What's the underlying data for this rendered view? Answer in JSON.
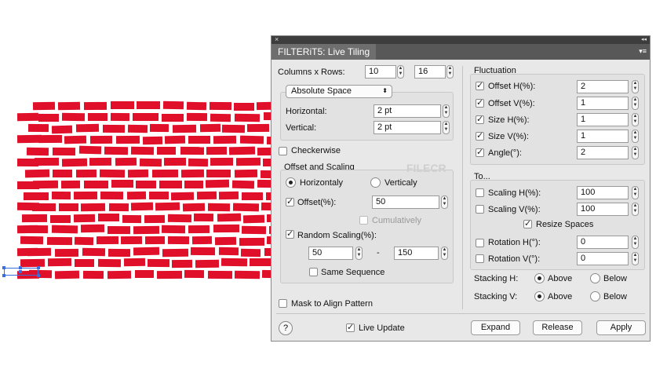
{
  "panel": {
    "close_glyph": "×",
    "collapse_glyph": "◂◂",
    "menu_glyph": "▾≡",
    "title": "FILTERiT5: Live Tiling"
  },
  "left": {
    "cols_rows_label": "Columns x Rows:",
    "columns": "10",
    "rows": "16",
    "space_mode": "Absolute Space",
    "horizontal_label": "Horizontal:",
    "horizontal": "2 pt",
    "vertical_label": "Vertical:",
    "vertical": "2 pt",
    "checkerwise_label": "Checkerwise",
    "offset_scaling_title": "Offset and Scaling",
    "horizontally_label": "Horizontaly",
    "vertically_label": "Verticaly",
    "offset_label": "Offset(%):",
    "offset": "50",
    "cumulatively_label": "Cumulatively",
    "random_scaling_label": "Random Scaling(%):",
    "random_min": "50",
    "random_dash": "-",
    "random_max": "150",
    "same_sequence_label": "Same Sequence",
    "mask_label": "Mask to Align Pattern"
  },
  "right": {
    "fluctuation_title": "Fluctuation",
    "fluct": [
      {
        "label": "Offset H(%):",
        "value": "2",
        "checked": true
      },
      {
        "label": "Offset V(%):",
        "value": "1",
        "checked": true
      },
      {
        "label": "Size H(%):",
        "value": "1",
        "checked": true
      },
      {
        "label": "Size V(%):",
        "value": "1",
        "checked": true
      },
      {
        "label": "Angle(°):",
        "value": "2",
        "checked": true
      }
    ],
    "to_title": "To...",
    "scaling_h_label": "Scaling H(%):",
    "scaling_h": "100",
    "scaling_v_label": "Scaling V(%):",
    "scaling_v": "100",
    "resize_spaces_label": "Resize Spaces",
    "rotation_h_label": "Rotation H(°):",
    "rotation_h": "0",
    "rotation_v_label": "Rotation V(°):",
    "rotation_v": "0",
    "stacking_h_label": "Stacking H:",
    "stacking_v_label": "Stacking V:",
    "above_label": "Above",
    "below_label": "Below"
  },
  "footer": {
    "help": "?",
    "live_update_label": "Live Update",
    "expand": "Expand",
    "release": "Release",
    "apply": "Apply"
  },
  "check_glyph": "✓",
  "spin_up": "▲",
  "spin_down": "▼",
  "dropdown_arrows": "⬍",
  "watermark": "FILECR",
  "brick_color": "#e0102a",
  "selection_color": "#3a6de0"
}
